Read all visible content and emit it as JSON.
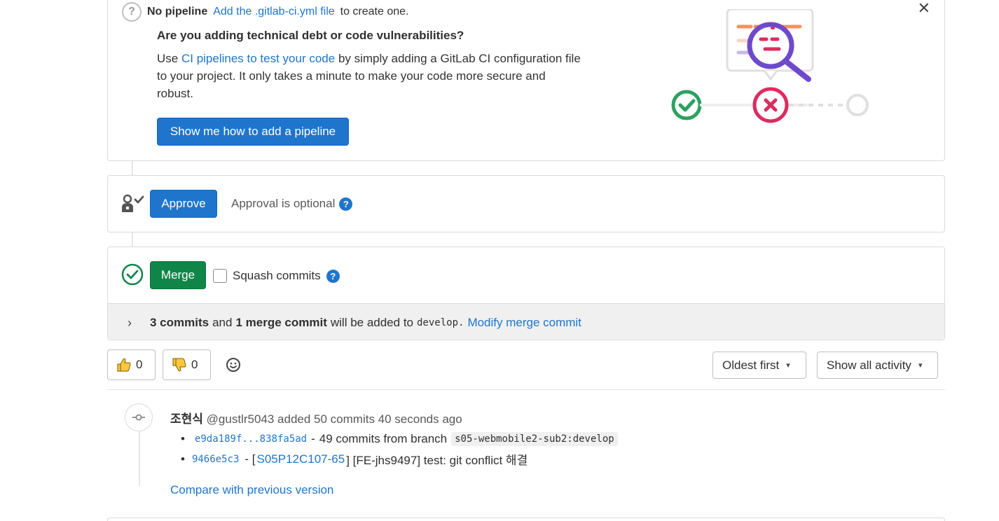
{
  "pipeline": {
    "no_pipeline_label": "No pipeline",
    "add_file_link": "Add the .gitlab-ci.yml file",
    "create_text": "to create one.",
    "question": "Are you adding technical debt or code vulnerabilities?",
    "body_prefix": "Use",
    "body_link": "CI pipelines to test your code",
    "body_suffix": "by simply adding a GitLab CI configuration file to your project. It only takes a minute to make your code more secure and robust.",
    "button_label": "Show me how to add a pipeline"
  },
  "approval": {
    "button_label": "Approve",
    "status_text": "Approval is optional"
  },
  "merge": {
    "button_label": "Merge",
    "squash_label": "Squash commits",
    "commit_count": "3 commits",
    "and_text": "and",
    "merge_commit_count": "1 merge commit",
    "will_be_added": "will be added to",
    "target_branch": "develop.",
    "modify_link": "Modify merge commit"
  },
  "reactions": {
    "thumbsup_count": "0",
    "thumbsdown_count": "0"
  },
  "sort": {
    "selected": "Oldest first"
  },
  "filter": {
    "selected": "Show all activity"
  },
  "activity": {
    "author_name": "조현식",
    "author_handle": "@gustlr5043",
    "action": "added 50 commits 40 seconds ago",
    "commits": [
      {
        "sha": "e9da189f...838fa5ad",
        "separator": "-",
        "text": "49 commits from branch",
        "branch": "s05-webmobile2-sub2:develop"
      },
      {
        "sha": "9466e5c3",
        "separator": "- [",
        "issue": "S05P12C107-65",
        "text": "] [FE-jhs9497] test: git conflict 해결"
      }
    ],
    "compare_link": "Compare with previous version"
  },
  "colors": {
    "primary_blue": "#1f75cb",
    "merge_green": "#108548",
    "success_green": "#2da160",
    "danger_red": "#dd2b60",
    "magnifier_purple": "#6e49cb"
  }
}
